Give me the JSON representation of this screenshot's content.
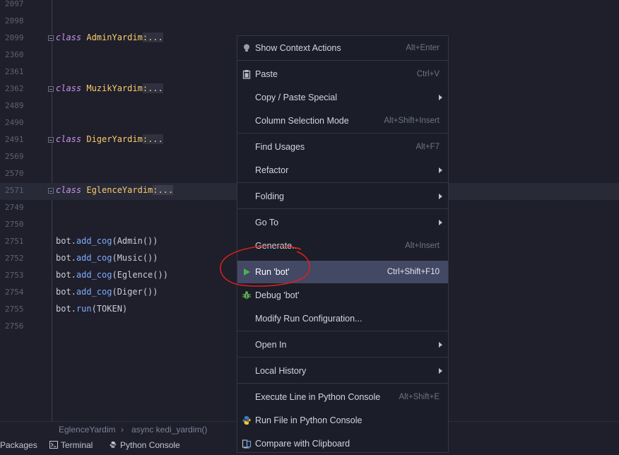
{
  "editor": {
    "lines": [
      {
        "num": "2097",
        "kind": "blank"
      },
      {
        "num": "2098",
        "kind": "blank"
      },
      {
        "num": "2099",
        "kind": "class",
        "keyword": "class",
        "name": "AdminYardim",
        "rest": ":..."
      },
      {
        "num": "2360",
        "kind": "blank"
      },
      {
        "num": "2361",
        "kind": "blank"
      },
      {
        "num": "2362",
        "kind": "class",
        "keyword": "class",
        "name": "MuzikYardim",
        "rest": ":..."
      },
      {
        "num": "2489",
        "kind": "blank"
      },
      {
        "num": "2490",
        "kind": "blank"
      },
      {
        "num": "2491",
        "kind": "class",
        "keyword": "class",
        "name": "DigerYardim",
        "rest": ":..."
      },
      {
        "num": "2569",
        "kind": "blank"
      },
      {
        "num": "2570",
        "kind": "blank"
      },
      {
        "num": "2571",
        "kind": "class",
        "keyword": "class",
        "name": "EglenceYardim",
        "rest": ":...",
        "current": true
      },
      {
        "num": "2749",
        "kind": "blank"
      },
      {
        "num": "2750",
        "kind": "blank"
      },
      {
        "num": "2751",
        "kind": "call",
        "obj": "bot.",
        "fn": "add_cog",
        "args": "(Admin())"
      },
      {
        "num": "2752",
        "kind": "call",
        "obj": "bot.",
        "fn": "add_cog",
        "args": "(Music())"
      },
      {
        "num": "2753",
        "kind": "call",
        "obj": "bot.",
        "fn": "add_cog",
        "args": "(Eglence())"
      },
      {
        "num": "2754",
        "kind": "call",
        "obj": "bot.",
        "fn": "add_cog",
        "args": "(Diger())"
      },
      {
        "num": "2755",
        "kind": "call",
        "obj": "bot.",
        "fn": "run",
        "args": "(TOKEN)"
      },
      {
        "num": "2756",
        "kind": "blank"
      }
    ]
  },
  "breadcrumb": {
    "items": [
      "EglenceYardim",
      "async kedi_yardim()"
    ],
    "separator": "›"
  },
  "tool_windows": {
    "packages": "Packages",
    "terminal": "Terminal",
    "python_console": "Python Console"
  },
  "context_menu": {
    "items": [
      {
        "label": "Show Context Actions",
        "shortcut": "Alt+Enter",
        "icon": "bulb-icon"
      },
      {
        "label": "Paste",
        "shortcut": "Ctrl+V",
        "icon": "clipboard-icon"
      },
      {
        "label": "Copy / Paste Special",
        "submenu": true
      },
      {
        "label": "Column Selection Mode",
        "shortcut": "Alt+Shift+Insert"
      },
      {
        "label": "Find Usages",
        "shortcut": "Alt+F7"
      },
      {
        "label": "Refactor",
        "submenu": true
      },
      {
        "label": "Folding",
        "submenu": true
      },
      {
        "label": "Go To",
        "submenu": true
      },
      {
        "label": "Generate...",
        "shortcut": "Alt+Insert"
      },
      {
        "label": "Run 'bot'",
        "shortcut": "Ctrl+Shift+F10",
        "icon": "run-icon",
        "highlighted": true
      },
      {
        "label": "Debug 'bot'",
        "icon": "debug-icon"
      },
      {
        "label": "Modify Run Configuration..."
      },
      {
        "label": "Open In",
        "submenu": true
      },
      {
        "label": "Local History",
        "submenu": true
      },
      {
        "label": "Execute Line in Python Console",
        "shortcut": "Alt+Shift+E"
      },
      {
        "label": "Run File in Python Console",
        "icon": "python-icon"
      },
      {
        "label": "Compare with Clipboard",
        "icon": "compare-icon"
      }
    ]
  },
  "colors": {
    "background": "#1e1f2b",
    "menu_highlight": "#434864",
    "run_green": "#4caf50",
    "annotation_red": "#e0201c",
    "keyword": "#c792ea",
    "class_name": "#ffcb6b",
    "function": "#82aaff"
  }
}
